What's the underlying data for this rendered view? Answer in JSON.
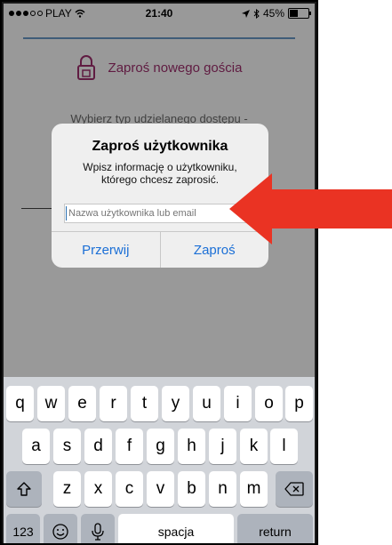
{
  "status_bar": {
    "carrier": "PLAY",
    "time": "21:40",
    "battery": "45%"
  },
  "background": {
    "title": "Zaproś nowego gościa",
    "subtitle": "Wybierz typ udzielanego dostępu -"
  },
  "alert": {
    "title": "Zaproś użytkownika",
    "message_line1": "Wpisz informację o użytkowniku,",
    "message_line2": "którego chcesz zaprosić.",
    "input_placeholder": "Nazwa użytkownika lub email",
    "input_value": "",
    "cancel_label": "Przerwij",
    "confirm_label": "Zaproś"
  },
  "keyboard": {
    "row1": [
      "q",
      "w",
      "e",
      "r",
      "t",
      "y",
      "u",
      "i",
      "o",
      "p"
    ],
    "row2": [
      "a",
      "s",
      "d",
      "f",
      "g",
      "h",
      "j",
      "k",
      "l"
    ],
    "row3": [
      "z",
      "x",
      "c",
      "v",
      "b",
      "n",
      "m"
    ],
    "numbers_label": "123",
    "space_label": "spacja",
    "return_label": "return"
  },
  "colors": {
    "accent": "#1b6fd6",
    "brand": "#a0306e",
    "arrow": "#ea3323"
  }
}
